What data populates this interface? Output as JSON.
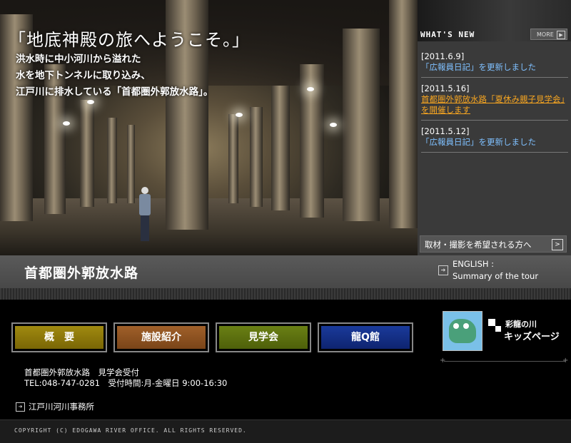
{
  "hero": {
    "title": "「地底神殿の旅へようこそ。」",
    "subtitle_lines": [
      "洪水時に中小河川から溢れた",
      "水を地下トンネルに取り込み、",
      "江戸川に排水している「首都圏外郭放水路」。"
    ]
  },
  "news": {
    "heading": "WHAT'S NEW",
    "more_label": "MORE",
    "items": [
      {
        "date": "[2011.6.9]",
        "text": "「広報員日記」を更新しました"
      },
      {
        "date": "[2011.5.16]",
        "text": "首都圏外郭放水路「夏休み親子見学会」を開催します"
      },
      {
        "date": "[2011.5.12]",
        "text": "「広報員日記」を更新しました"
      }
    ],
    "press_label": "取材・撮影を希望される方へ"
  },
  "namebar": {
    "title": "首都圏外郭放水路",
    "english_line1": "ENGLISH :",
    "english_line2": "Summary of the tour"
  },
  "nav": {
    "items": [
      "概　要",
      "施設紹介",
      "見学会",
      "龍Q館"
    ]
  },
  "kids": {
    "line1": "彩龍の川",
    "line2": "キッズページ"
  },
  "contact": {
    "line1": "首都圏外郭放水路　見学会受付",
    "line2": "TEL:048-747-0281　受付時間:月-金曜日 9:00-16:30",
    "office": "江戸川河川事務所"
  },
  "footer": {
    "copyright": "COPYRIGHT (C) EDOGAWA RIVER OFFICE. ALL RIGHTS RESERVED."
  }
}
